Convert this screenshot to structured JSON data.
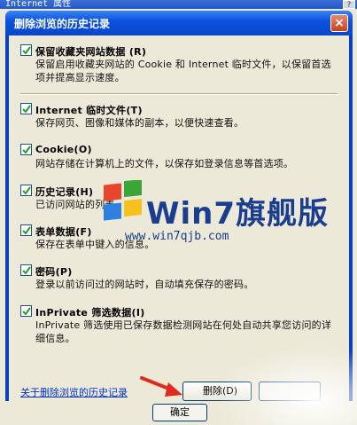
{
  "parent": {
    "title": "Internet 属性",
    "help": "?",
    "ok_label": "确定"
  },
  "dialog": {
    "title": "删除浏览的历史记录",
    "close": "×",
    "options": [
      {
        "label": "保留收藏夹网站数据 (R)",
        "desc": "保留启用收藏夹网站的 Cookie 和 Internet 临时文件，以保留首选项并提高显示速度。",
        "checked": true
      },
      {
        "label": "Internet 临时文件(T)",
        "desc": "保存网页、图像和媒体的副本，以便快速查看。",
        "checked": true
      },
      {
        "label": "Cookie(O)",
        "desc": "网站存储在计算机上的文件，以保存如登录信息等首选项。",
        "checked": true
      },
      {
        "label": "历史记录(H)",
        "desc": "已访问网站的列表。",
        "checked": true
      },
      {
        "label": "表单数据(F)",
        "desc": "保存在表单中键入的信息。",
        "checked": true
      },
      {
        "label": "密码(P)",
        "desc": "登录以前访问过的网站时，自动填充保存的密码。",
        "checked": true
      },
      {
        "label": "InPrivate 筛选数据(I)",
        "desc": "InPrivate 筛选使用已保存数据检测网站在何处自动共享您访问的详细信息。",
        "checked": true
      }
    ],
    "about_link": "关于删除浏览的历史记录",
    "delete_label": "删除(D)"
  },
  "watermark": {
    "text": "Win7旗舰版",
    "url": "www.win7qjb.com"
  },
  "colors": {
    "titlebar": "#0a46c8",
    "dialog_bg": "#ece9d8",
    "check": "#21a121",
    "arrow": "#e02a1e",
    "link": "#0033cc"
  }
}
